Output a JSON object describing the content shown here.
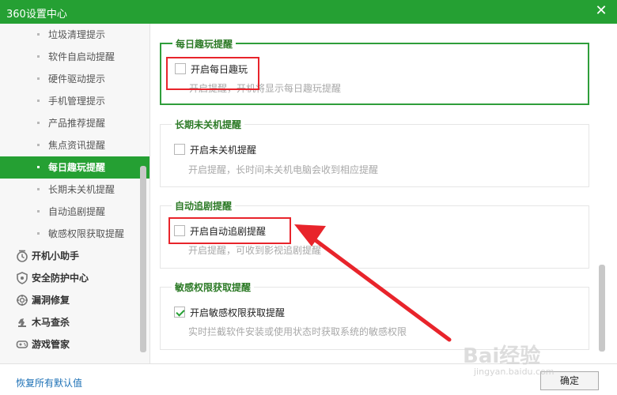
{
  "window": {
    "title": "360设置中心",
    "close_label": "✕"
  },
  "sidebar": {
    "sub_items": [
      {
        "label": "垃圾清理提示",
        "active": false
      },
      {
        "label": "软件自启动提醒",
        "active": false
      },
      {
        "label": "硬件驱动提示",
        "active": false
      },
      {
        "label": "手机管理提示",
        "active": false
      },
      {
        "label": "产品推荐提醒",
        "active": false
      },
      {
        "label": "焦点资讯提醒",
        "active": false
      },
      {
        "label": "每日趣玩提醒",
        "active": true
      },
      {
        "label": "长期未关机提醒",
        "active": false
      },
      {
        "label": "自动追剧提醒",
        "active": false
      },
      {
        "label": "敏感权限获取提醒",
        "active": false
      }
    ],
    "categories": [
      {
        "label": "开机小助手",
        "icon": "clock-icon"
      },
      {
        "label": "安全防护中心",
        "icon": "shield-icon"
      },
      {
        "label": "漏洞修复",
        "icon": "patch-icon"
      },
      {
        "label": "木马查杀",
        "icon": "trojan-icon"
      },
      {
        "label": "游戏管家",
        "icon": "gamepad-icon"
      }
    ]
  },
  "groups": [
    {
      "title": "每日趣玩提醒",
      "checkbox_label": "开启每日趣玩",
      "checked": false,
      "description": "开启提醒，开机将显示每日趣玩提醒"
    },
    {
      "title": "长期未关机提醒",
      "checkbox_label": "开启未关机提醒",
      "checked": false,
      "description": "开启提醒，长时间未关机电脑会收到相应提醒"
    },
    {
      "title": "自动追剧提醒",
      "checkbox_label": "开启自动追剧提醒",
      "checked": false,
      "description": "开启提醒，可收到影视追剧提醒"
    },
    {
      "title": "敏感权限获取提醒",
      "checkbox_label": "开启敏感权限获取提醒",
      "checked": true,
      "description": "实时拦截软件安装或使用状态时获取系统的敏感权限"
    }
  ],
  "footer": {
    "restore_label": "恢复所有默认值",
    "ok_label": "确定"
  },
  "watermark": {
    "main": "Bai经验",
    "sub": "jingyan.baidu.com"
  },
  "colors": {
    "brand": "#25a033",
    "annotation": "#e8242b"
  }
}
